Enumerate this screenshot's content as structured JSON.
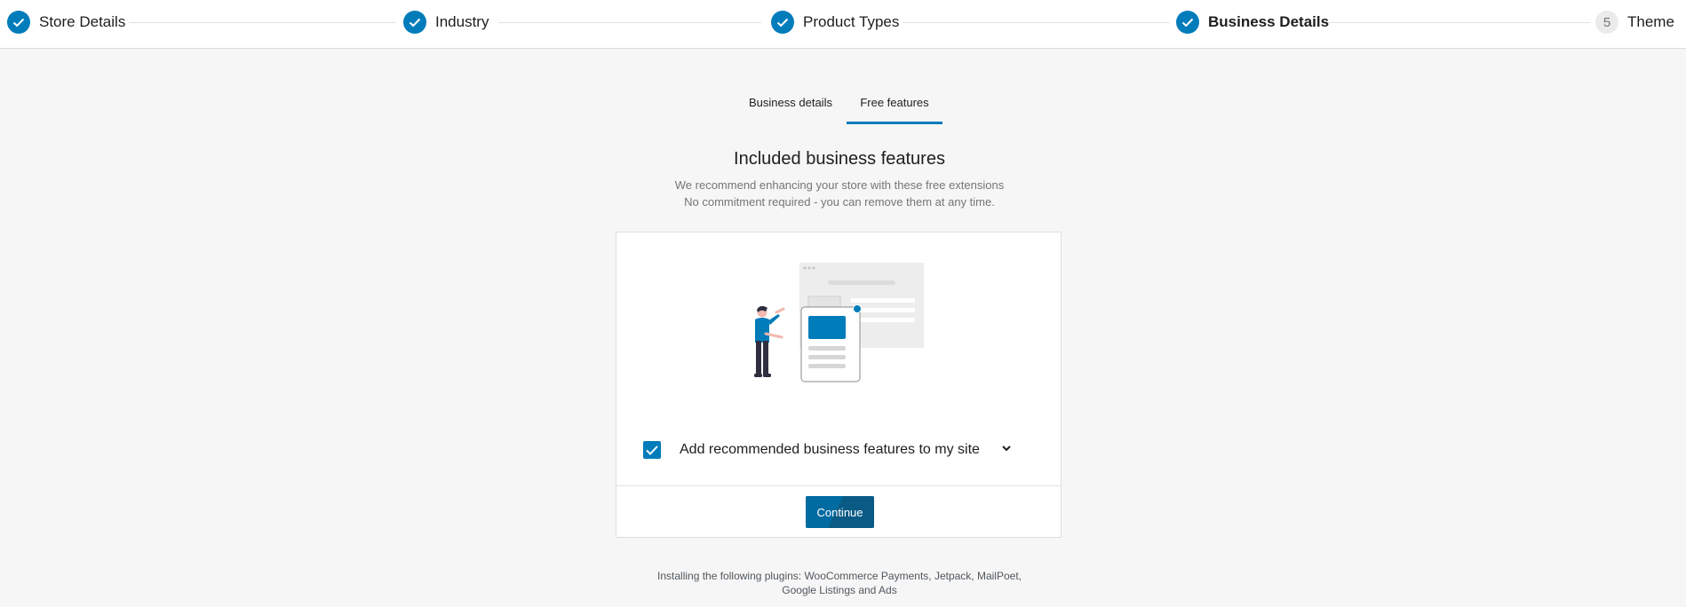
{
  "stepper": {
    "steps": [
      {
        "label": "Store Details",
        "state": "done"
      },
      {
        "label": "Industry",
        "state": "done"
      },
      {
        "label": "Product Types",
        "state": "done"
      },
      {
        "label": "Business Details",
        "state": "current"
      },
      {
        "label": "Theme",
        "state": "pending",
        "number": "5"
      }
    ]
  },
  "tabs": [
    {
      "label": "Business details",
      "active": false
    },
    {
      "label": "Free features",
      "active": true
    }
  ],
  "heading": {
    "title": "Included business features",
    "subtitle_line1": "We recommend enhancing your store with these free extensions",
    "subtitle_line2": "No commitment required - you can remove them at any time."
  },
  "card": {
    "checkbox_label": "Add recommended business features to my site",
    "checkbox_checked": true,
    "continue_label": "Continue"
  },
  "footer": {
    "line1": "Installing the following plugins: WooCommerce Payments, Jetpack, MailPoet,",
    "line2": "Google Listings and Ads"
  },
  "colors": {
    "accent": "#007cba",
    "button": "#006ba1",
    "background": "#f6f6f6"
  }
}
